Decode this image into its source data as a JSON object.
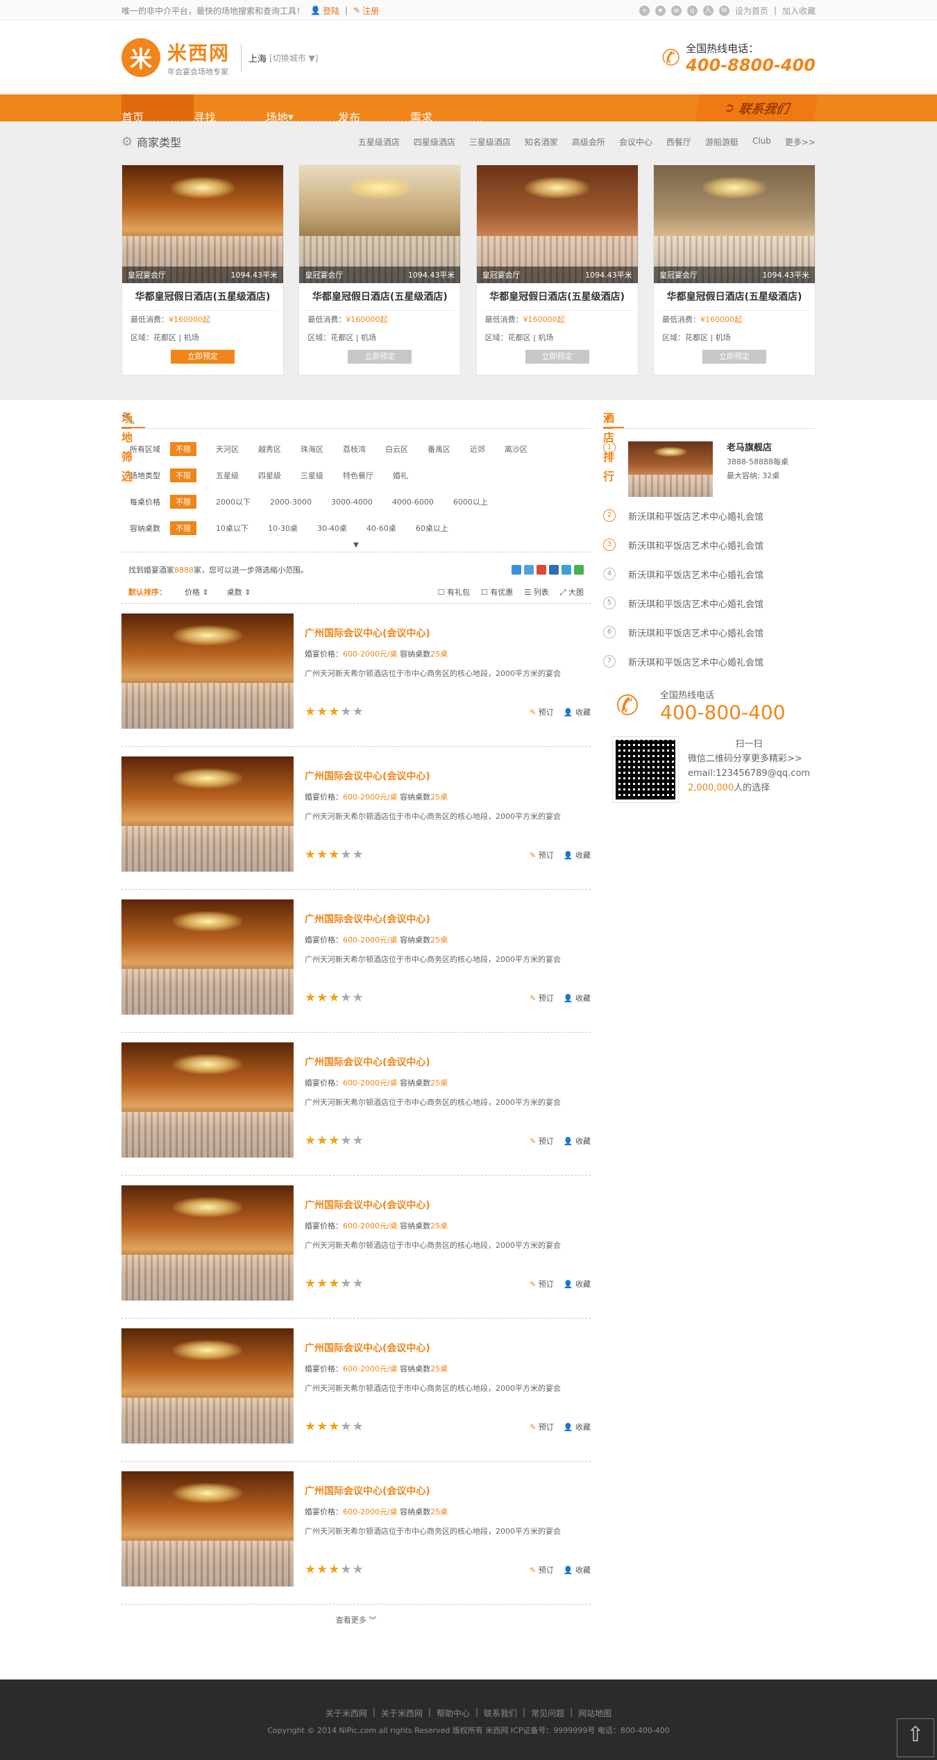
{
  "topbar": {
    "slogan": "唯一的非中介平台，最快的场地搜索和查询工具！",
    "login": "登陆",
    "register": "注册",
    "set_home": "设为首页",
    "favorite": "加入收藏"
  },
  "header": {
    "logo_mark": "米",
    "logo_name": "米西网",
    "logo_slogan": "年会宴会场地专家",
    "city": "上海",
    "switch_city": "[切换城市",
    "switch_city_end": "]",
    "hotline_label": "全国热线电话：",
    "hotline_number": "400-8800-400"
  },
  "nav": {
    "items": [
      "首页",
      "寻找",
      "场地",
      "发布",
      "需求"
    ],
    "contact": "联系我们"
  },
  "merchant": {
    "title": "商家类型",
    "links": [
      "五星级酒店",
      "四星级酒店",
      "三星级酒店",
      "知名酒家",
      "高级会所",
      "会议中心",
      "西餐厅",
      "游船游艇",
      "Club",
      "更多>>"
    ]
  },
  "cards": [
    {
      "hall": "皇冠宴会厅",
      "area": "1094.43平米",
      "name": "华都皇冠假日酒店(五星级酒店)",
      "min_label": "最低消费：",
      "min_price": "¥160000起",
      "area_label": "区域：",
      "district": "花都区 | 机场",
      "button": "立即预定"
    },
    {
      "hall": "皇冠宴会厅",
      "area": "1094.43平米",
      "name": "华都皇冠假日酒店(五星级酒店)",
      "min_label": "最低消费：",
      "min_price": "¥160000起",
      "area_label": "区域：",
      "district": "花都区 | 机场",
      "button": "立即预定"
    },
    {
      "hall": "皇冠宴会厅",
      "area": "1094.43平米",
      "name": "华都皇冠假日酒店(五星级酒店)",
      "min_label": "最低消费：",
      "min_price": "¥160000起",
      "area_label": "区域：",
      "district": "花都区 | 机场",
      "button": "立即预定"
    },
    {
      "hall": "皇冠宴会厅",
      "area": "1094.43平米",
      "name": "华都皇冠假日酒店(五星级酒店)",
      "min_label": "最低消费：",
      "min_price": "¥160000起",
      "area_label": "区域：",
      "district": "花都区 | 机场",
      "button": "立即预定"
    }
  ],
  "filter": {
    "title": "场地筛选",
    "rows": [
      {
        "label": "所有区域",
        "options": [
          "不限",
          "天河区",
          "越秀区",
          "珠海区",
          "荔枝湾",
          "白云区",
          "番禺区",
          "近郊",
          "离沙区"
        ]
      },
      {
        "label": "场地类型",
        "options": [
          "不限",
          "五星级",
          "四星级",
          "三星级",
          "特色餐厅",
          "婚礼"
        ]
      },
      {
        "label": "每桌价格",
        "options": [
          "不限",
          "2000以下",
          "2000-3000",
          "3000-4000",
          "4000-6000",
          "6000以上"
        ]
      },
      {
        "label": "容纳桌数",
        "options": [
          "不限",
          "10桌以下",
          "10-30桌",
          "30-40桌",
          "40-60桌",
          "60桌以上"
        ]
      }
    ],
    "expand": "▼"
  },
  "results": {
    "found_pre": "找到婚宴酒家",
    "found_count": "8888",
    "found_post": "家，您可以进一步筛选缩小范围。",
    "sort_default": "默认排序：",
    "sort_price": "价格 ⇕",
    "sort_tables": "桌数 ⇕",
    "has_gift": "有礼包",
    "has_discount": "有优惠",
    "view_list": "列表",
    "view_large": "大图",
    "more": "查看更多 ︾"
  },
  "venues": [
    {
      "name": "广州国际会议中心(会议中心)",
      "price_label": "婚宴价格：",
      "price": "600-2000元/桌",
      "cap_label": " 容纳桌数",
      "cap": "25桌",
      "desc": "广州天河新天希尔顿酒店位于市中心商务区的核心地段，2000平方米的宴会",
      "rating": 3,
      "book": "预订",
      "fav": "收藏"
    },
    {
      "name": "广州国际会议中心(会议中心)",
      "price_label": "婚宴价格：",
      "price": "600-2000元/桌",
      "cap_label": " 容纳桌数",
      "cap": "25桌",
      "desc": "广州天河新天希尔顿酒店位于市中心商务区的核心地段，2000平方米的宴会",
      "rating": 3,
      "book": "预订",
      "fav": "收藏"
    },
    {
      "name": "广州国际会议中心(会议中心)",
      "price_label": "婚宴价格：",
      "price": "600-2000元/桌",
      "cap_label": " 容纳桌数",
      "cap": "25桌",
      "desc": "广州天河新天希尔顿酒店位于市中心商务区的核心地段，2000平方米的宴会",
      "rating": 3,
      "book": "预订",
      "fav": "收藏"
    },
    {
      "name": "广州国际会议中心(会议中心)",
      "price_label": "婚宴价格：",
      "price": "600-2000元/桌",
      "cap_label": " 容纳桌数",
      "cap": "25桌",
      "desc": "广州天河新天希尔顿酒店位于市中心商务区的核心地段，2000平方米的宴会",
      "rating": 3,
      "book": "预订",
      "fav": "收藏"
    },
    {
      "name": "广州国际会议中心(会议中心)",
      "price_label": "婚宴价格：",
      "price": "600-2000元/桌",
      "cap_label": " 容纳桌数",
      "cap": "25桌",
      "desc": "广州天河新天希尔顿酒店位于市中心商务区的核心地段，2000平方米的宴会",
      "rating": 3,
      "book": "预订",
      "fav": "收藏"
    },
    {
      "name": "广州国际会议中心(会议中心)",
      "price_label": "婚宴价格：",
      "price": "600-2000元/桌",
      "cap_label": " 容纳桌数",
      "cap": "25桌",
      "desc": "广州天河新天希尔顿酒店位于市中心商务区的核心地段，2000平方米的宴会",
      "rating": 3,
      "book": "预订",
      "fav": "收藏"
    },
    {
      "name": "广州国际会议中心(会议中心)",
      "price_label": "婚宴价格：",
      "price": "600-2000元/桌",
      "cap_label": " 容纳桌数",
      "cap": "25桌",
      "desc": "广州天河新天希尔顿酒店位于市中心商务区的核心地段，2000平方米的宴会",
      "rating": 3,
      "book": "预订",
      "fav": "收藏"
    }
  ],
  "ranking": {
    "title": "酒店排行",
    "top": {
      "num": "1",
      "name": "老马旗舰店",
      "phone": "3888-58888每桌",
      "capacity": "最大容纳: 32桌"
    },
    "items": [
      {
        "num": "2",
        "name": "新沃琪和平饭店艺术中心婚礼会馆"
      },
      {
        "num": "3",
        "name": "新沃琪和平饭店艺术中心婚礼会馆"
      },
      {
        "num": "4",
        "name": "新沃琪和平饭店艺术中心婚礼会馆"
      },
      {
        "num": "5",
        "name": "新沃琪和平饭店艺术中心婚礼会馆"
      },
      {
        "num": "6",
        "name": "新沃琪和平饭店艺术中心婚礼会馆"
      },
      {
        "num": "7",
        "name": "新沃琪和平饭店艺术中心婚礼会馆"
      }
    ]
  },
  "contact_box": {
    "label": "全国热线电话",
    "number": "400-800-400",
    "scan": "扫一扫",
    "wechat": "微信二维码分享更多精彩>>",
    "email": "email:123456789@qq.com",
    "users": "2,000,000",
    "users_post": "人的选择"
  },
  "footer": {
    "links": [
      "关于米西网",
      "关于米西网",
      "帮助中心",
      "联系我们",
      "常见问题",
      "网站地图"
    ],
    "copyright": "Copyright © 2014 NiPic.com all rights Reserved 版权所有 米西网 ICP证备号：9999999号 电话：800-400-400"
  },
  "colors": {
    "accent": "#f08519",
    "footer": "#2b2b2b"
  }
}
